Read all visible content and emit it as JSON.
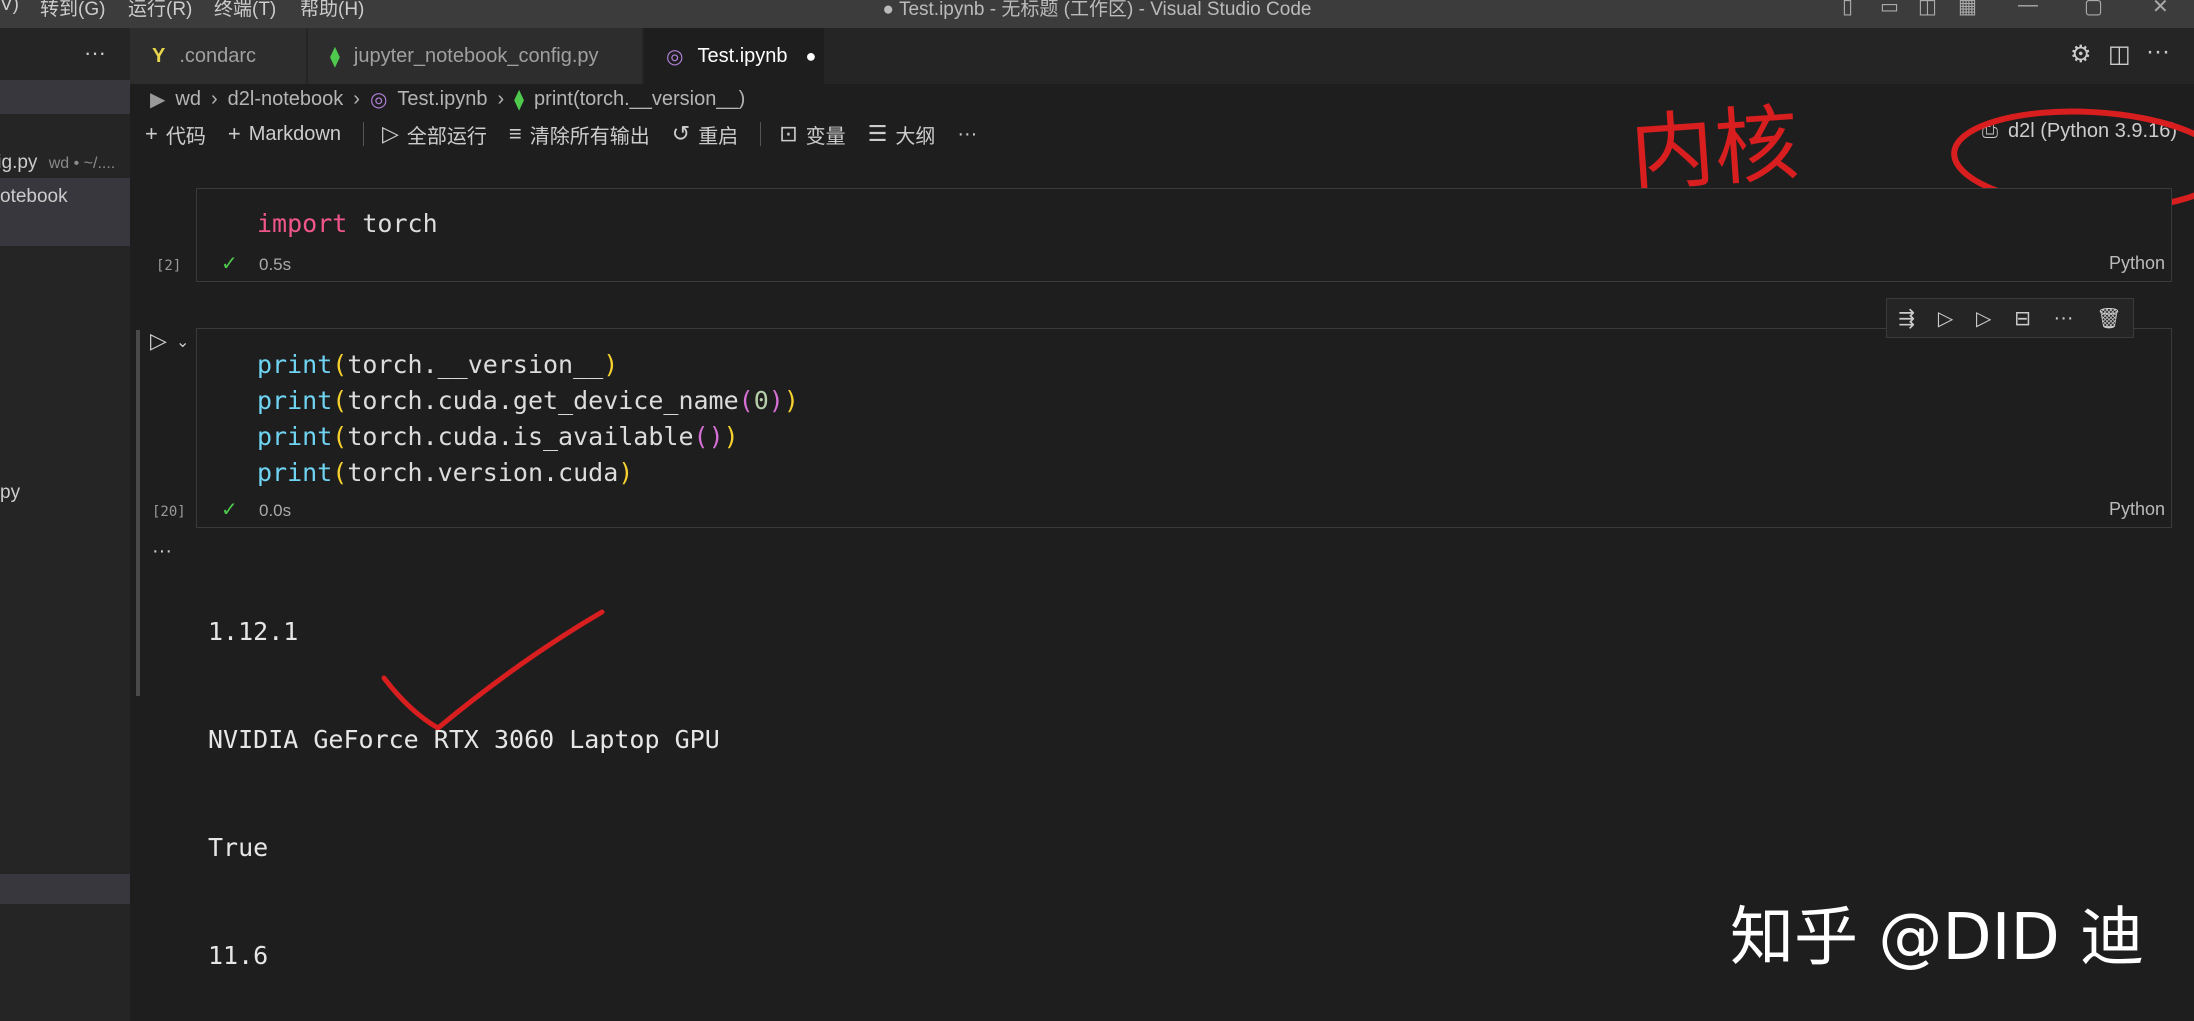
{
  "titlebar": {
    "menus": [
      "V)",
      "转到(G)",
      "运行(R)",
      "终端(T)",
      "帮助(H)"
    ],
    "window_title": "● Test.ipynb - 无标题 (工作区) - Visual Studio Code"
  },
  "sidebar": {
    "more_label": "···",
    "items": [
      {
        "label": "fig.py",
        "detail": "wd • ~/...."
      },
      {
        "label": "otebook"
      },
      {
        "label": "py"
      }
    ]
  },
  "tabs": [
    {
      "label": ".condarc",
      "icon": "yaml-icon",
      "glyph": "Y"
    },
    {
      "label": "jupyter_notebook_config.py",
      "icon": "python-icon",
      "glyph": "⧫"
    },
    {
      "label": "Test.ipynb",
      "icon": "notebook-icon",
      "glyph": "◎",
      "dirty": "●"
    }
  ],
  "editor_actions": [
    "⚙",
    "◫",
    "···"
  ],
  "breadcrumbs": [
    "wd",
    "d2l-notebook",
    "Test.ipynb",
    "print(torch.__version__)"
  ],
  "breadcrumb_sep": "›",
  "toolbar": {
    "add_code": "代码",
    "add_markdown": "Markdown",
    "run_all": "全部运行",
    "clear_outputs": "清除所有输出",
    "restart": "重启",
    "variables": "变量",
    "outline": "大纲",
    "more": "···"
  },
  "kernel": {
    "label": "d2l (Python 3.9.16)"
  },
  "annotation": {
    "text": "内核"
  },
  "cells": [
    {
      "exec_count": "[2]",
      "duration": "0.5s",
      "language": "Python",
      "code_lines": [
        "import torch"
      ]
    },
    {
      "exec_count": "[20]",
      "duration": "0.0s",
      "language": "Python",
      "code_lines": [
        "print(torch.__version__)",
        "print(torch.cuda.get_device_name(0))",
        "print(torch.cuda.is_available())",
        "print(torch.version.cuda)"
      ],
      "output": [
        "1.12.1",
        "NVIDIA GeForce RTX 3060 Laptop GPU",
        "True",
        "11.6"
      ]
    }
  ],
  "cell_toolbar": [
    "run-by-line-icon",
    "execute-above-icon",
    "execute-below-icon",
    "split-cell-icon",
    "more-icon",
    "delete-icon"
  ],
  "watermark": "知乎 @DID 迪",
  "colors": {
    "keyword": "#f0568c",
    "function": "#6fd3f2",
    "paren": "#f5d02e",
    "paren2": "#d670d6",
    "annotation_red": "#d81e1e",
    "check_green": "#4ec94e"
  }
}
